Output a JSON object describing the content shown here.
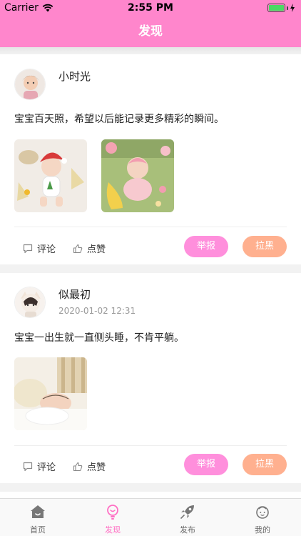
{
  "status_bar": {
    "carrier": "Carrier",
    "time": "2:55 PM"
  },
  "nav": {
    "title": "发现"
  },
  "posts": [
    {
      "username": "小时光",
      "timestamp": "",
      "text": "宝宝百天照，希望以后能记录更多精彩的瞬间。",
      "comment_label": "评论",
      "like_label": "点赞",
      "report_label": "举报",
      "block_label": "拉黑"
    },
    {
      "username": "似最初",
      "timestamp": "2020-01-02 12:31",
      "text": "宝宝一出生就一直侧头睡，不肯平躺。",
      "comment_label": "评论",
      "like_label": "点赞",
      "report_label": "举报",
      "block_label": "拉黑"
    }
  ],
  "tabs": [
    {
      "label": "首页",
      "icon": "home-icon"
    },
    {
      "label": "发现",
      "icon": "bulb-icon"
    },
    {
      "label": "发布",
      "icon": "rocket-icon"
    },
    {
      "label": "我的",
      "icon": "face-icon"
    }
  ],
  "colors": {
    "accent": "#ff86cc",
    "report": "#ff8fdc",
    "block": "#ffb08f",
    "tab_active": "#ff6fc4"
  }
}
